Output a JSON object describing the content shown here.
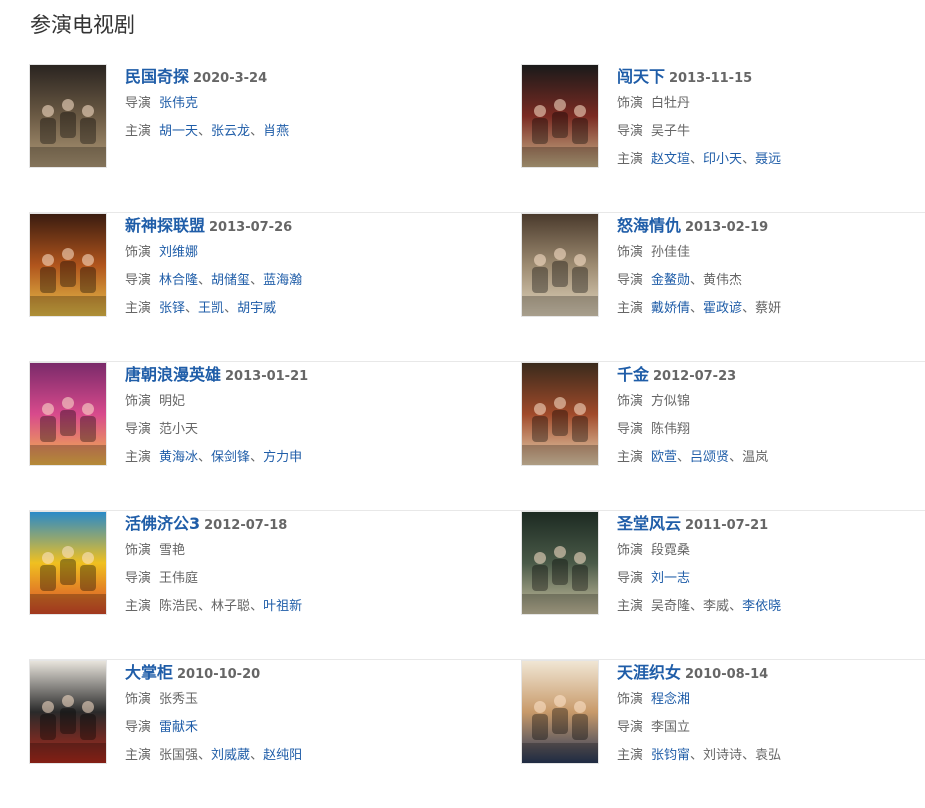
{
  "section_title": "参演电视剧",
  "dramas": [
    {
      "title": "民国奇探",
      "date": "2020-3-24",
      "credits": [
        {
          "label": "导演",
          "people": [
            {
              "name": "张伟克",
              "link": true
            }
          ]
        },
        {
          "label": "主演",
          "people": [
            {
              "name": "胡一天",
              "link": true
            },
            {
              "name": "张云龙",
              "link": true
            },
            {
              "name": "肖燕",
              "link": true
            }
          ]
        }
      ],
      "poster_colors": [
        "#2a2420",
        "#6b5a44",
        "#b09a78"
      ]
    },
    {
      "title": "闯天下",
      "date": "2013-11-15",
      "credits": [
        {
          "label": "饰演",
          "people": [
            {
              "name": "白牡丹",
              "link": false
            }
          ]
        },
        {
          "label": "导演",
          "people": [
            {
              "name": "吴子牛",
              "link": false
            }
          ]
        },
        {
          "label": "主演",
          "people": [
            {
              "name": "赵文瑄",
              "link": true
            },
            {
              "name": "印小天",
              "link": true
            },
            {
              "name": "聂远",
              "link": true
            }
          ]
        }
      ],
      "poster_colors": [
        "#1a1a1a",
        "#7a2a22",
        "#c9b38a"
      ]
    },
    {
      "title": "新神探联盟",
      "date": "2013-07-26",
      "credits": [
        {
          "label": "饰演",
          "people": [
            {
              "name": "刘维娜",
              "link": true
            }
          ]
        },
        {
          "label": "导演",
          "people": [
            {
              "name": "林合隆",
              "link": true
            },
            {
              "name": "胡储玺",
              "link": true
            },
            {
              "name": "蓝海瀚",
              "link": true
            }
          ]
        },
        {
          "label": "主演",
          "people": [
            {
              "name": "张铎",
              "link": true
            },
            {
              "name": "王凯",
              "link": true
            },
            {
              "name": "胡宇威",
              "link": true
            }
          ]
        }
      ],
      "poster_colors": [
        "#3a1c10",
        "#b0541c",
        "#e8c04a"
      ]
    },
    {
      "title": "怒海情仇",
      "date": "2013-02-19",
      "credits": [
        {
          "label": "饰演",
          "people": [
            {
              "name": "孙佳佳",
              "link": false
            }
          ]
        },
        {
          "label": "导演",
          "people": [
            {
              "name": "金鳌勋",
              "link": true
            },
            {
              "name": "黄伟杰",
              "link": false
            }
          ]
        },
        {
          "label": "主演",
          "people": [
            {
              "name": "戴娇倩",
              "link": true
            },
            {
              "name": "霍政谚",
              "link": true
            },
            {
              "name": "蔡妍",
              "link": false
            }
          ]
        }
      ],
      "poster_colors": [
        "#4a3a2c",
        "#9c8a70",
        "#e0d4bc"
      ]
    },
    {
      "title": "唐朝浪漫英雄",
      "date": "2013-01-21",
      "credits": [
        {
          "label": "饰演",
          "people": [
            {
              "name": "明妃",
              "link": false
            }
          ]
        },
        {
          "label": "导演",
          "people": [
            {
              "name": "范小天",
              "link": false
            }
          ]
        },
        {
          "label": "主演",
          "people": [
            {
              "name": "黄海冰",
              "link": true
            },
            {
              "name": "保剑锋",
              "link": true
            },
            {
              "name": "方力申",
              "link": true
            }
          ]
        }
      ],
      "poster_colors": [
        "#7a2a6a",
        "#d84a8c",
        "#f2b84a"
      ]
    },
    {
      "title": "千金",
      "date": "2012-07-23",
      "credits": [
        {
          "label": "饰演",
          "people": [
            {
              "name": "方似锦",
              "link": false
            }
          ]
        },
        {
          "label": "导演",
          "people": [
            {
              "name": "陈伟翔",
              "link": false
            }
          ]
        },
        {
          "label": "主演",
          "people": [
            {
              "name": "欧萱",
              "link": true
            },
            {
              "name": "吕颂贤",
              "link": true
            },
            {
              "name": "温岚",
              "link": false
            }
          ]
        }
      ],
      "poster_colors": [
        "#3a2a1c",
        "#a04a2a",
        "#e8d2b0"
      ]
    },
    {
      "title": "活佛济公3",
      "date": "2012-07-18",
      "credits": [
        {
          "label": "饰演",
          "people": [
            {
              "name": "雪艳",
              "link": false
            }
          ]
        },
        {
          "label": "导演",
          "people": [
            {
              "name": "王伟庭",
              "link": false
            }
          ]
        },
        {
          "label": "主演",
          "people": [
            {
              "name": "陈浩民",
              "link": false
            },
            {
              "name": "林子聪",
              "link": false
            },
            {
              "name": "叶祖新",
              "link": true
            }
          ]
        }
      ],
      "poster_colors": [
        "#2a8ac8",
        "#f0c020",
        "#d84a2a"
      ]
    },
    {
      "title": "圣堂风云",
      "date": "2011-07-21",
      "credits": [
        {
          "label": "饰演",
          "people": [
            {
              "name": "段霓桑",
              "link": false
            }
          ]
        },
        {
          "label": "导演",
          "people": [
            {
              "name": "刘一志",
              "link": true
            }
          ]
        },
        {
          "label": "主演",
          "people": [
            {
              "name": "吴奇隆",
              "link": false
            },
            {
              "name": "李威",
              "link": false
            },
            {
              "name": "李依晓",
              "link": true
            }
          ]
        }
      ],
      "poster_colors": [
        "#1c2a22",
        "#4a5a48",
        "#c8c0a0"
      ]
    },
    {
      "title": "大掌柜",
      "date": "2010-10-20",
      "credits": [
        {
          "label": "饰演",
          "people": [
            {
              "name": "张秀玉",
              "link": false
            }
          ]
        },
        {
          "label": "导演",
          "people": [
            {
              "name": "雷献禾",
              "link": true
            }
          ]
        },
        {
          "label": "主演",
          "people": [
            {
              "name": "张国强",
              "link": false
            },
            {
              "name": "刘威葳",
              "link": true
            },
            {
              "name": "赵纯阳",
              "link": true
            }
          ]
        }
      ],
      "poster_colors": [
        "#e8e4dc",
        "#2a2a2a",
        "#b02a1c"
      ]
    },
    {
      "title": "天涯织女",
      "date": "2010-08-14",
      "credits": [
        {
          "label": "饰演",
          "people": [
            {
              "name": "程念湘",
              "link": true
            }
          ]
        },
        {
          "label": "导演",
          "people": [
            {
              "name": "李国立",
              "link": false
            }
          ]
        },
        {
          "label": "主演",
          "people": [
            {
              "name": "张钧甯",
              "link": true
            },
            {
              "name": "刘诗诗",
              "link": false
            },
            {
              "name": "袁弘",
              "link": false
            }
          ]
        }
      ],
      "poster_colors": [
        "#f0e6d4",
        "#c89a6a",
        "#2a3a5a"
      ]
    }
  ]
}
